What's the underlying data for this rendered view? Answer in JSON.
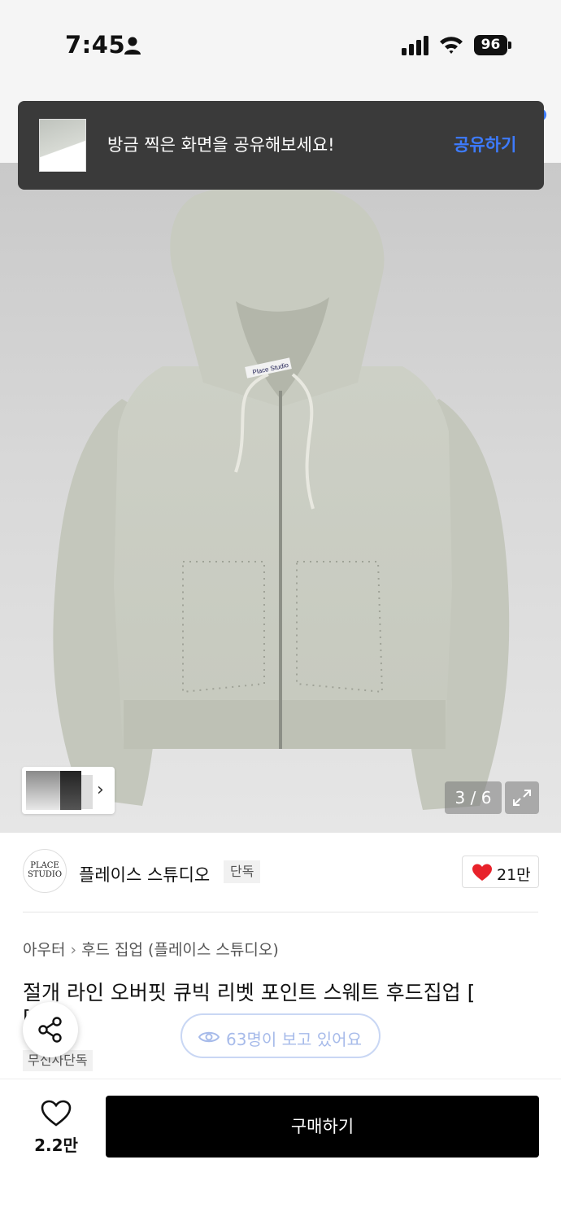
{
  "status_bar": {
    "time": "7:45",
    "battery": "96",
    "icons": [
      "person-icon",
      "signal-icon",
      "wifi-icon",
      "battery-icon"
    ]
  },
  "toast": {
    "message": "방금 찍은 화면을 공유해보세요!",
    "action": "공유하기"
  },
  "gallery": {
    "page_indicator": "3 / 6",
    "current_page": 3,
    "total_pages": 6,
    "tag_text": "Place Studio"
  },
  "brand": {
    "logo_text": "PLACE STUDIO",
    "name": "플레이스 스튜디오",
    "badge": "단독",
    "like_count": "21만"
  },
  "product": {
    "breadcrumb": [
      "아우터",
      "후드 집업 (플레이스 스튜디오)"
    ],
    "title": "절개 라인 오버핏 큐빅 리벳 포인트 스웨트 후드집업 [",
    "title_cut": "[",
    "exclusive_tag": "무신사단독"
  },
  "viewers": {
    "text": "63명이 보고 있어요"
  },
  "bottom_bar": {
    "wish_count": "2.2만",
    "buy_label": "구매하기"
  },
  "colors": {
    "accent_blue": "#3d7bff",
    "heart_red": "#e8222a",
    "buy_black": "#000000"
  }
}
